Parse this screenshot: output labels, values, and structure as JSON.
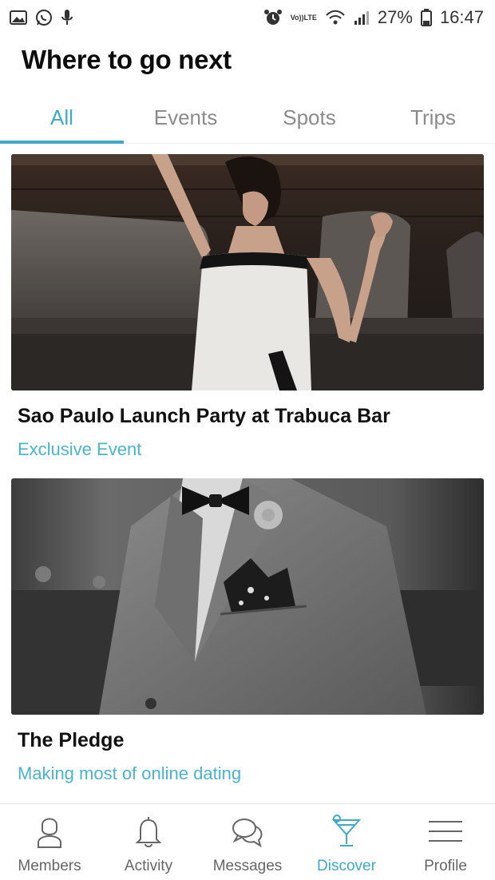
{
  "status_bar": {
    "left_icons": [
      "gallery-icon",
      "whatsapp-icon",
      "microphone-icon"
    ],
    "right_icons": [
      "alarm-icon",
      "volte-icon",
      "wifi-icon",
      "signal-icon",
      "battery-icon"
    ],
    "volte_line1": "Vo))",
    "volte_line2": "LTE",
    "battery": "27%",
    "time": "16:47"
  },
  "header": {
    "title": "Where to go next"
  },
  "tabs": [
    {
      "label": "All",
      "active": true
    },
    {
      "label": "Events",
      "active": false
    },
    {
      "label": "Spots",
      "active": false
    },
    {
      "label": "Trips",
      "active": false
    }
  ],
  "cards": [
    {
      "title": "Sao Paulo Launch Party at Trabuca Bar",
      "subtitle": "Exclusive Event"
    },
    {
      "title": "The Pledge",
      "subtitle": "Making most of online dating"
    }
  ],
  "bottom_nav": [
    {
      "label": "Members",
      "icon": "members-icon",
      "active": false
    },
    {
      "label": "Activity",
      "icon": "bell-icon",
      "active": false
    },
    {
      "label": "Messages",
      "icon": "chat-icon",
      "active": false
    },
    {
      "label": "Discover",
      "icon": "cocktail-icon",
      "active": true
    },
    {
      "label": "Profile",
      "icon": "menu-icon",
      "active": false
    }
  ],
  "colors": {
    "accent": "#3fa9c7",
    "inactive": "#8b8b8b"
  }
}
